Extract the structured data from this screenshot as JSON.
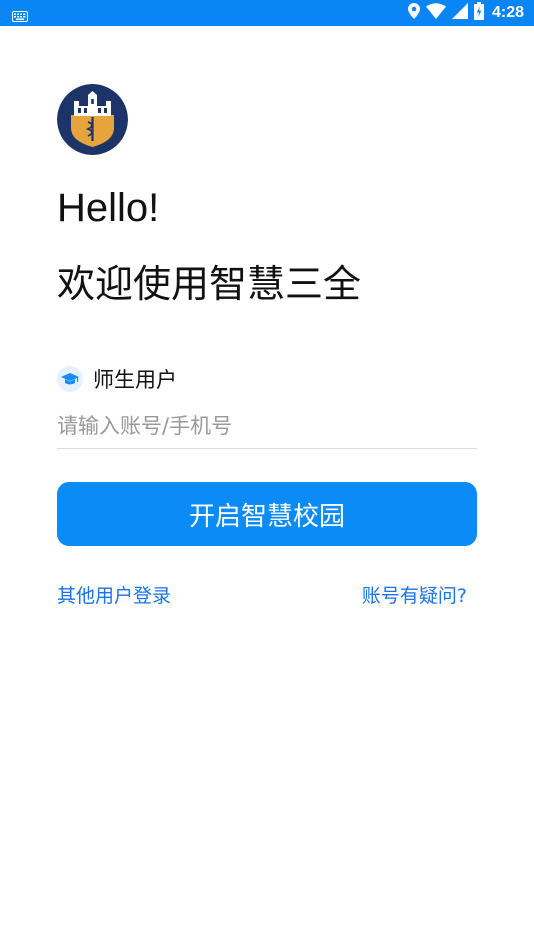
{
  "status_bar": {
    "time": "4:28",
    "background_color": "#0a85f5",
    "icons": [
      "keyboard-icon",
      "location-icon",
      "wifi-icon",
      "cellular-signal-icon",
      "battery-icon"
    ]
  },
  "logo": {
    "icon": "school-crest-logo"
  },
  "greeting": {
    "hello": "Hello!",
    "welcome": "欢迎使用智慧三全"
  },
  "user_type": {
    "icon": "graduation-cap-icon",
    "label": "师生用户"
  },
  "account_input": {
    "value": "",
    "placeholder": "请输入账号/手机号"
  },
  "primary_button": {
    "label": "开启智慧校园",
    "color": "#0b8bf6"
  },
  "links": {
    "other_login": "其他用户登录",
    "account_question": "账号有疑问?",
    "color": "#1a73e8"
  }
}
